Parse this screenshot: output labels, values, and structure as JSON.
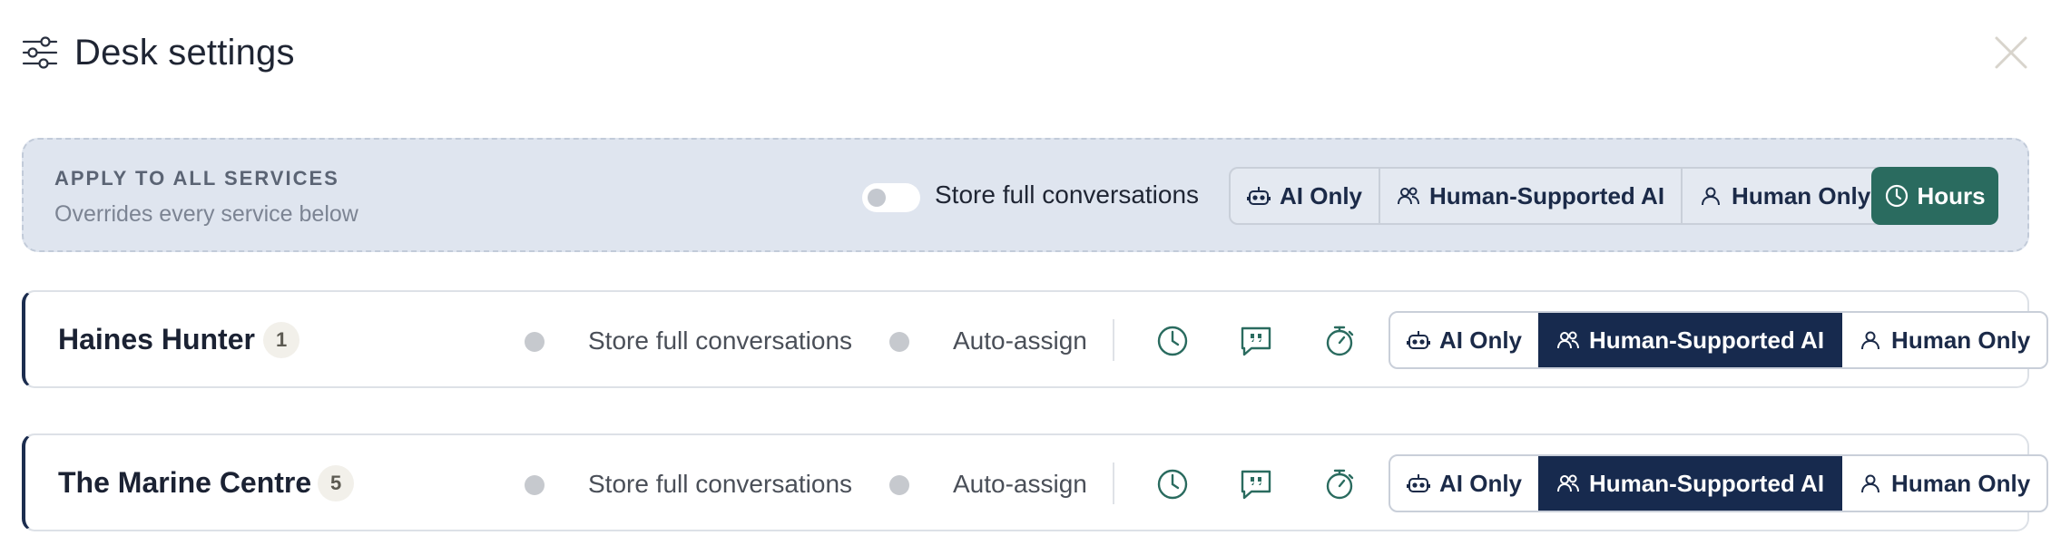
{
  "header": {
    "title": "Desk settings"
  },
  "apply_all": {
    "heading": "APPLY TO ALL SERVICES",
    "subheading": "Overrides every service below",
    "store_label": "Store full conversations",
    "modes": [
      "AI Only",
      "Human-Supported AI",
      "Human Only"
    ],
    "hours_label": "Hours"
  },
  "services": [
    {
      "name": "Haines Hunter",
      "count": "1",
      "store_label": "Store full conversations",
      "auto_label": "Auto-assign",
      "modes": [
        "AI Only",
        "Human-Supported AI",
        "Human Only"
      ],
      "active_mode": "Human-Supported AI"
    },
    {
      "name": "The Marine Centre",
      "count": "5",
      "store_label": "Store full conversations",
      "auto_label": "Auto-assign",
      "modes": [
        "AI Only",
        "Human-Supported AI",
        "Human Only"
      ],
      "active_mode": "Human-Supported AI"
    }
  ],
  "icons": {
    "title": "sliders-icon",
    "close": "close-icon",
    "ai": "robot-icon",
    "human_supported": "users-icon",
    "human": "user-icon",
    "hours": "clock-icon",
    "service_tools": [
      "clock-icon",
      "quote-bubble-icon",
      "stopwatch-icon"
    ]
  },
  "colors": {
    "primary_navy": "#172a4e",
    "accent_green": "#2a6b5f",
    "banner_bg": "#dfe5ef",
    "icon_green": "#2a6b5f"
  }
}
